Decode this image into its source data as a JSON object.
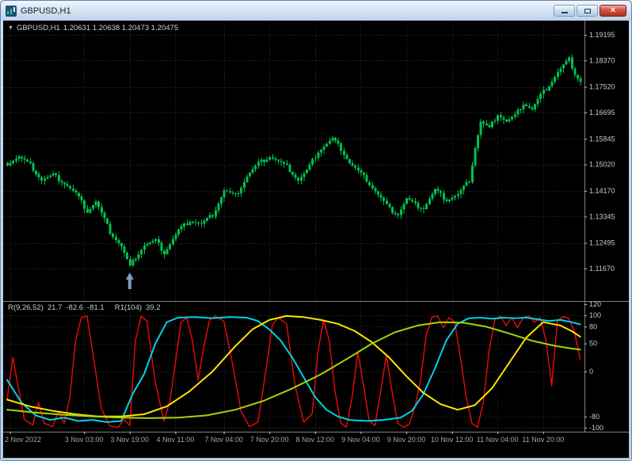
{
  "window": {
    "title": "GBPUSD,H1"
  },
  "icons": {
    "minimize": "horizontal-bar",
    "restore": "window-box",
    "close_glyph": "×",
    "symbol_dropdown": "▼",
    "annotation_arrow": "up-arrow"
  },
  "main_chart": {
    "dropdown_glyph": "▼",
    "symbol": "GBPUSD,H1",
    "ohlc": "1.20631 1.20638 1.20473 1.20475"
  },
  "price_axis": {
    "labels": [
      "1.19195",
      "1.18370",
      "1.17520",
      "1.16695",
      "1.15845",
      "1.15020",
      "1.14170",
      "1.13345",
      "1.12495",
      "1.11670"
    ]
  },
  "time_axis": {
    "labels": [
      {
        "text": "2 Nov 2022",
        "i": 1
      },
      {
        "text": "3 Nov 03:00",
        "i": 27
      },
      {
        "text": "3 Nov 19:00",
        "i": 43
      },
      {
        "text": "4 Nov 11:00",
        "i": 59
      },
      {
        "text": "7 Nov 04:00",
        "i": 76
      },
      {
        "text": "7 Nov 20:00",
        "i": 92
      },
      {
        "text": "8 Nov 12:00",
        "i": 108
      },
      {
        "text": "9 Nov 04:00",
        "i": 124
      },
      {
        "text": "9 Nov 20:00",
        "i": 140
      },
      {
        "text": "10 Nov 12:00",
        "i": 156
      },
      {
        "text": "11 Nov 04:00",
        "i": 172
      },
      {
        "text": "11 Nov 20:00",
        "i": 188
      }
    ]
  },
  "indicator_pane": {
    "label_parts": [
      "R(9,26,52)",
      "21.7",
      "-82.6",
      "-81.1",
      "R1(104)",
      "39.2"
    ],
    "axis_labels": [
      "120",
      "100",
      "80",
      "50",
      "0",
      "-80",
      "-100"
    ]
  },
  "colors": {
    "background": "#000000",
    "candle": "#00bf50",
    "red_line": "#ee0a0a",
    "cyan_line": "#00d2e6",
    "yellow_line": "#ffe400",
    "chartreuse_line": "#a6d40a",
    "arrow": "#7d9cc6",
    "grid": "#2e2e2e",
    "axis_text": "#c8c8c8",
    "time_text": "#a6a6a6",
    "separator": "#808080"
  },
  "chart_data": {
    "type": "candlestick",
    "symbol": "GBPUSD",
    "timeframe": "H1",
    "title": "GBPUSD,H1",
    "price_axis_ticks": [
      1.19195,
      1.1837,
      1.1752,
      1.16695,
      1.15845,
      1.1502,
      1.1417,
      1.13345,
      1.12495,
      1.1167
    ],
    "time_axis_ticks": [
      "2 Nov 2022",
      "3 Nov 03:00",
      "3 Nov 19:00",
      "4 Nov 11:00",
      "7 Nov 04:00",
      "7 Nov 20:00",
      "8 Nov 12:00",
      "9 Nov 04:00",
      "9 Nov 20:00",
      "10 Nov 12:00",
      "11 Nov 04:00",
      "11 Nov 20:00"
    ],
    "candle_count": 202,
    "close_anchors": [
      [
        0,
        1.1505
      ],
      [
        4,
        1.1528
      ],
      [
        8,
        1.15
      ],
      [
        12,
        1.1452
      ],
      [
        16,
        1.1468
      ],
      [
        20,
        1.1442
      ],
      [
        24,
        1.1408
      ],
      [
        28,
        1.1352
      ],
      [
        31,
        1.1382
      ],
      [
        36,
        1.1285
      ],
      [
        40,
        1.1238
      ],
      [
        43,
        1.1172
      ],
      [
        45,
        1.1205
      ],
      [
        48,
        1.1242
      ],
      [
        52,
        1.1256
      ],
      [
        55,
        1.1218
      ],
      [
        60,
        1.129
      ],
      [
        64,
        1.1322
      ],
      [
        68,
        1.131
      ],
      [
        72,
        1.134
      ],
      [
        76,
        1.1418
      ],
      [
        80,
        1.14
      ],
      [
        84,
        1.1465
      ],
      [
        88,
        1.1505
      ],
      [
        92,
        1.1528
      ],
      [
        95,
        1.1512
      ],
      [
        98,
        1.1495
      ],
      [
        102,
        1.1452
      ],
      [
        105,
        1.1482
      ],
      [
        109,
        1.1545
      ],
      [
        114,
        1.1585
      ],
      [
        117,
        1.1552
      ],
      [
        120,
        1.1508
      ],
      [
        122,
        1.149
      ],
      [
        126,
        1.1452
      ],
      [
        130,
        1.1405
      ],
      [
        134,
        1.1358
      ],
      [
        137,
        1.1342
      ],
      [
        140,
        1.1392
      ],
      [
        143,
        1.1372
      ],
      [
        146,
        1.1362
      ],
      [
        150,
        1.142
      ],
      [
        154,
        1.1388
      ],
      [
        158,
        1.1405
      ],
      [
        162,
        1.1452
      ],
      [
        164,
        1.1558
      ],
      [
        166,
        1.164
      ],
      [
        169,
        1.1618
      ],
      [
        172,
        1.1665
      ],
      [
        175,
        1.164
      ],
      [
        178,
        1.1658
      ],
      [
        181,
        1.17
      ],
      [
        184,
        1.168
      ],
      [
        187,
        1.1725
      ],
      [
        190,
        1.1758
      ],
      [
        193,
        1.18
      ],
      [
        197,
        1.184
      ],
      [
        199,
        1.1795
      ],
      [
        201,
        1.177
      ]
    ],
    "annotation": {
      "type": "up-arrow",
      "candle_index": 43,
      "price": 1.1167
    },
    "indicator": {
      "label": "R(9,26,52) 21.7 -82.6 -81.1 R1(104) 39.2",
      "range": [
        -100,
        120
      ],
      "levels": [
        100,
        80,
        50,
        0,
        -80,
        -100
      ],
      "series": [
        {
          "name": "r-fast-red",
          "color_key": "red_line",
          "width": 1.4,
          "points": [
            [
              0,
              -50
            ],
            [
              2,
              25
            ],
            [
              4,
              -30
            ],
            [
              6,
              -85
            ],
            [
              9,
              -95
            ],
            [
              11,
              -55
            ],
            [
              13,
              -92
            ],
            [
              16,
              -98
            ],
            [
              18,
              -70
            ],
            [
              20,
              -92
            ],
            [
              22,
              -45
            ],
            [
              24,
              55
            ],
            [
              26,
              96
            ],
            [
              28,
              99
            ],
            [
              30,
              35
            ],
            [
              33,
              -65
            ],
            [
              36,
              -97
            ],
            [
              39,
              -99
            ],
            [
              41,
              -85
            ],
            [
              43,
              -96
            ],
            [
              45,
              55
            ],
            [
              47,
              99
            ],
            [
              49,
              90
            ],
            [
              52,
              -20
            ],
            [
              55,
              -88
            ],
            [
              57,
              -55
            ],
            [
              59,
              15
            ],
            [
              61,
              88
            ],
            [
              63,
              96
            ],
            [
              65,
              55
            ],
            [
              67,
              -15
            ],
            [
              69,
              45
            ],
            [
              71,
              92
            ],
            [
              73,
              99
            ],
            [
              76,
              90
            ],
            [
              79,
              15
            ],
            [
              82,
              -70
            ],
            [
              85,
              -98
            ],
            [
              88,
              -90
            ],
            [
              91,
              10
            ],
            [
              93,
              82
            ],
            [
              95,
              96
            ],
            [
              98,
              85
            ],
            [
              101,
              -25
            ],
            [
              104,
              -90
            ],
            [
              107,
              -75
            ],
            [
              109,
              35
            ],
            [
              111,
              92
            ],
            [
              113,
              55
            ],
            [
              115,
              -35
            ],
            [
              117,
              -92
            ],
            [
              119,
              -99
            ],
            [
              121,
              -45
            ],
            [
              123,
              35
            ],
            [
              125,
              -25
            ],
            [
              127,
              -88
            ],
            [
              129,
              -96
            ],
            [
              131,
              -35
            ],
            [
              133,
              28
            ],
            [
              135,
              -35
            ],
            [
              137,
              -92
            ],
            [
              139,
              -99
            ],
            [
              141,
              -94
            ],
            [
              143,
              -65
            ],
            [
              145,
              -15
            ],
            [
              147,
              65
            ],
            [
              149,
              97
            ],
            [
              151,
              99
            ],
            [
              153,
              78
            ],
            [
              155,
              96
            ],
            [
              157,
              88
            ],
            [
              159,
              25
            ],
            [
              161,
              -45
            ],
            [
              163,
              -92
            ],
            [
              165,
              -99
            ],
            [
              167,
              -55
            ],
            [
              169,
              35
            ],
            [
              171,
              92
            ],
            [
              173,
              99
            ],
            [
              175,
              82
            ],
            [
              177,
              96
            ],
            [
              179,
              78
            ],
            [
              181,
              96
            ],
            [
              183,
              99
            ],
            [
              185,
              88
            ],
            [
              187,
              96
            ],
            [
              189,
              55
            ],
            [
              191,
              -25
            ],
            [
              193,
              90
            ],
            [
              195,
              98
            ],
            [
              197,
              95
            ],
            [
              199,
              70
            ],
            [
              201,
              22
            ]
          ]
        },
        {
          "name": "r-mid-cyan",
          "color_key": "cyan_line",
          "width": 2,
          "points": [
            [
              0,
              -15
            ],
            [
              5,
              -55
            ],
            [
              10,
              -78
            ],
            [
              15,
              -86
            ],
            [
              20,
              -82
            ],
            [
              25,
              -88
            ],
            [
              30,
              -86
            ],
            [
              35,
              -90
            ],
            [
              40,
              -88
            ],
            [
              44,
              -40
            ],
            [
              48,
              -5
            ],
            [
              52,
              50
            ],
            [
              56,
              88
            ],
            [
              60,
              96
            ],
            [
              66,
              97
            ],
            [
              72,
              95
            ],
            [
              78,
              97
            ],
            [
              84,
              96
            ],
            [
              88,
              90
            ],
            [
              92,
              75
            ],
            [
              96,
              55
            ],
            [
              100,
              25
            ],
            [
              104,
              -10
            ],
            [
              108,
              -45
            ],
            [
              112,
              -68
            ],
            [
              116,
              -80
            ],
            [
              120,
              -86
            ],
            [
              126,
              -88
            ],
            [
              132,
              -86
            ],
            [
              138,
              -82
            ],
            [
              142,
              -70
            ],
            [
              146,
              -40
            ],
            [
              150,
              5
            ],
            [
              154,
              55
            ],
            [
              158,
              85
            ],
            [
              162,
              95
            ],
            [
              166,
              96
            ],
            [
              170,
              94
            ],
            [
              174,
              96
            ],
            [
              178,
              95
            ],
            [
              182,
              96
            ],
            [
              186,
              93
            ],
            [
              190,
              90
            ],
            [
              194,
              92
            ],
            [
              198,
              88
            ],
            [
              201,
              84
            ]
          ]
        },
        {
          "name": "r-slow-yellow",
          "color_key": "yellow_line",
          "width": 2,
          "points": [
            [
              0,
              -50
            ],
            [
              8,
              -62
            ],
            [
              16,
              -70
            ],
            [
              24,
              -76
            ],
            [
              32,
              -80
            ],
            [
              40,
              -80
            ],
            [
              48,
              -76
            ],
            [
              56,
              -62
            ],
            [
              64,
              -35
            ],
            [
              72,
              0
            ],
            [
              80,
              45
            ],
            [
              86,
              75
            ],
            [
              92,
              92
            ],
            [
              98,
              99
            ],
            [
              104,
              97
            ],
            [
              110,
              92
            ],
            [
              116,
              85
            ],
            [
              122,
              72
            ],
            [
              128,
              52
            ],
            [
              134,
              25
            ],
            [
              140,
              -8
            ],
            [
              146,
              -38
            ],
            [
              152,
              -58
            ],
            [
              158,
              -68
            ],
            [
              164,
              -60
            ],
            [
              170,
              -30
            ],
            [
              176,
              15
            ],
            [
              182,
              60
            ],
            [
              188,
              88
            ],
            [
              194,
              82
            ],
            [
              198,
              72
            ],
            [
              201,
              62
            ]
          ]
        },
        {
          "name": "r1-104-chartreuse",
          "color_key": "chartreuse_line",
          "width": 2,
          "points": [
            [
              0,
              -68
            ],
            [
              10,
              -73
            ],
            [
              20,
              -77
            ],
            [
              30,
              -80
            ],
            [
              40,
              -82
            ],
            [
              50,
              -83
            ],
            [
              60,
              -82
            ],
            [
              70,
              -78
            ],
            [
              80,
              -68
            ],
            [
              90,
              -52
            ],
            [
              100,
              -30
            ],
            [
              110,
              -5
            ],
            [
              120,
              25
            ],
            [
              128,
              50
            ],
            [
              136,
              70
            ],
            [
              144,
              82
            ],
            [
              152,
              88
            ],
            [
              160,
              87
            ],
            [
              168,
              80
            ],
            [
              176,
              68
            ],
            [
              184,
              55
            ],
            [
              192,
              46
            ],
            [
              198,
              41
            ],
            [
              201,
              39
            ]
          ]
        }
      ]
    }
  }
}
